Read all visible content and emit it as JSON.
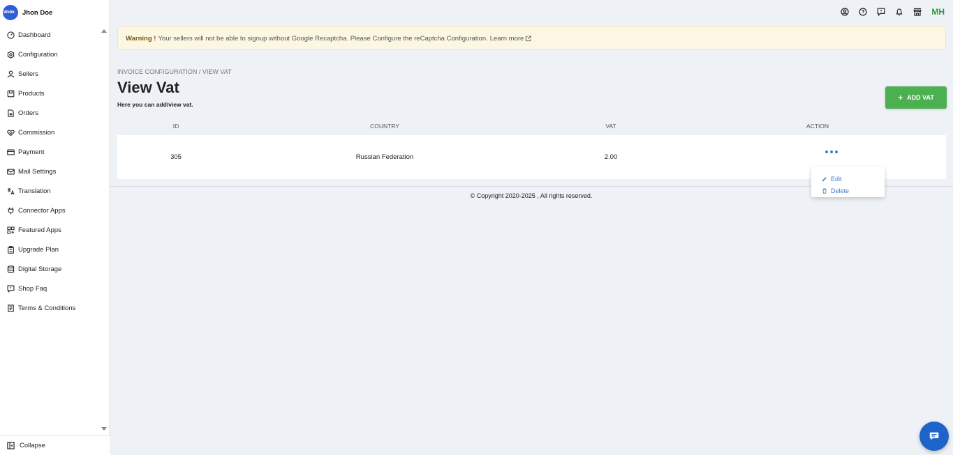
{
  "user": {
    "brand_logo_text": "Webk",
    "name": "Jhon Doe",
    "initials": "MH"
  },
  "sidebar": {
    "items": [
      {
        "label": "Dashboard",
        "icon": "dashboard-icon"
      },
      {
        "label": "Configuration",
        "icon": "gear-icon"
      },
      {
        "label": "Sellers",
        "icon": "user-icon"
      },
      {
        "label": "Products",
        "icon": "product-icon"
      },
      {
        "label": "Orders",
        "icon": "file-icon"
      },
      {
        "label": "Commission",
        "icon": "handshake-icon"
      },
      {
        "label": "Payment",
        "icon": "card-icon"
      },
      {
        "label": "Mail Settings",
        "icon": "mail-icon"
      },
      {
        "label": "Translation",
        "icon": "translate-icon"
      },
      {
        "label": "Connector Apps",
        "icon": "plug-icon"
      },
      {
        "label": "Featured Apps",
        "icon": "apps-icon"
      },
      {
        "label": "Upgrade Plan",
        "icon": "clipboard-icon"
      },
      {
        "label": "Digital Storage",
        "icon": "database-icon"
      },
      {
        "label": "Shop Faq",
        "icon": "faq-icon"
      },
      {
        "label": "Terms & Conditions",
        "icon": "document-icon"
      }
    ],
    "collapse_label": "Collapse"
  },
  "warning": {
    "strong": "Warning !",
    "text": "Your sellers will not be able to signup without Google Recaptcha. Please Configure the reCaptcha Configuration.",
    "link": "Learn more"
  },
  "page": {
    "breadcrumb_parent": "INVOICE CONFIGURATION",
    "breadcrumb_sep": " / ",
    "breadcrumb_current": "VIEW VAT",
    "title": "View Vat",
    "subtitle": "Here you can add/view vat.",
    "add_button": "ADD VAT"
  },
  "table": {
    "headers": {
      "id": "ID",
      "country": "COUNTRY",
      "vat": "VAT",
      "action": "ACTION"
    },
    "rows": [
      {
        "id": "305",
        "country": "Russian Federation",
        "vat": "2.00"
      }
    ]
  },
  "action_menu": {
    "edit": "Edit",
    "delete": "Delete"
  },
  "footer": {
    "copyright": "© Copyright 2020-2025 , All rights reserved."
  },
  "colors": {
    "accent": "#3d7bd1",
    "success": "#4caf50",
    "warning_bg": "#fcf7e3",
    "brand": "#2f5fd6"
  }
}
